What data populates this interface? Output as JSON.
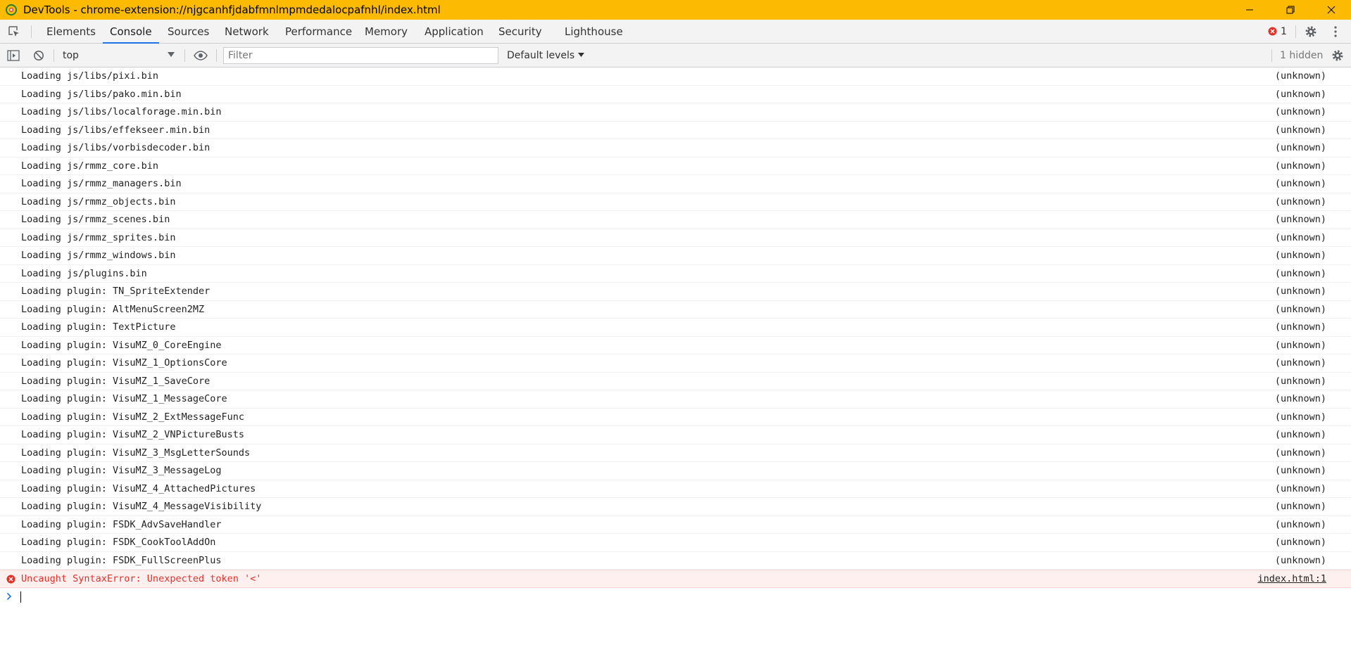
{
  "window": {
    "title": "DevTools - chrome-extension://njgcanhfjdabfmnlmpmdedalocpafnhl/index.html"
  },
  "tabs": [
    {
      "label": "Elements"
    },
    {
      "label": "Console",
      "selected": true
    },
    {
      "label": "Sources"
    },
    {
      "label": "Network"
    },
    {
      "label": "Performance"
    },
    {
      "label": "Memory"
    },
    {
      "label": "Application"
    },
    {
      "label": "Security"
    },
    {
      "label": "Lighthouse"
    }
  ],
  "error_badge": {
    "count": "1"
  },
  "console_toolbar": {
    "context": "top",
    "filter_placeholder": "Filter",
    "levels": "Default levels",
    "hidden": "1 hidden"
  },
  "messages": [
    {
      "text": "Loading js/libs/pixi.bin",
      "source": "(unknown)"
    },
    {
      "text": "Loading js/libs/pako.min.bin",
      "source": "(unknown)"
    },
    {
      "text": "Loading js/libs/localforage.min.bin",
      "source": "(unknown)"
    },
    {
      "text": "Loading js/libs/effekseer.min.bin",
      "source": "(unknown)"
    },
    {
      "text": "Loading js/libs/vorbisdecoder.bin",
      "source": "(unknown)"
    },
    {
      "text": "Loading js/rmmz_core.bin",
      "source": "(unknown)"
    },
    {
      "text": "Loading js/rmmz_managers.bin",
      "source": "(unknown)"
    },
    {
      "text": "Loading js/rmmz_objects.bin",
      "source": "(unknown)"
    },
    {
      "text": "Loading js/rmmz_scenes.bin",
      "source": "(unknown)"
    },
    {
      "text": "Loading js/rmmz_sprites.bin",
      "source": "(unknown)"
    },
    {
      "text": "Loading js/rmmz_windows.bin",
      "source": "(unknown)"
    },
    {
      "text": "Loading js/plugins.bin",
      "source": "(unknown)"
    },
    {
      "text": "Loading plugin: TN_SpriteExtender",
      "source": "(unknown)"
    },
    {
      "text": "Loading plugin: AltMenuScreen2MZ",
      "source": "(unknown)"
    },
    {
      "text": "Loading plugin: TextPicture",
      "source": "(unknown)"
    },
    {
      "text": "Loading plugin: VisuMZ_0_CoreEngine",
      "source": "(unknown)"
    },
    {
      "text": "Loading plugin: VisuMZ_1_OptionsCore",
      "source": "(unknown)"
    },
    {
      "text": "Loading plugin: VisuMZ_1_SaveCore",
      "source": "(unknown)"
    },
    {
      "text": "Loading plugin: VisuMZ_1_MessageCore",
      "source": "(unknown)"
    },
    {
      "text": "Loading plugin: VisuMZ_2_ExtMessageFunc",
      "source": "(unknown)"
    },
    {
      "text": "Loading plugin: VisuMZ_2_VNPictureBusts",
      "source": "(unknown)"
    },
    {
      "text": "Loading plugin: VisuMZ_3_MsgLetterSounds",
      "source": "(unknown)"
    },
    {
      "text": "Loading plugin: VisuMZ_3_MessageLog",
      "source": "(unknown)"
    },
    {
      "text": "Loading plugin: VisuMZ_4_AttachedPictures",
      "source": "(unknown)"
    },
    {
      "text": "Loading plugin: VisuMZ_4_MessageVisibility",
      "source": "(unknown)"
    },
    {
      "text": "Loading plugin: FSDK_AdvSaveHandler",
      "source": "(unknown)"
    },
    {
      "text": "Loading plugin: FSDK_CookToolAddOn",
      "source": "(unknown)"
    },
    {
      "text": "Loading plugin: FSDK_FullScreenPlus",
      "source": "(unknown)"
    }
  ],
  "error_message": {
    "text": "Uncaught SyntaxError: Unexpected token '<'",
    "source": "index.html:1"
  },
  "colors": {
    "titlebar": "#fdba03",
    "accent": "#1a73e8",
    "error": "#e0312b"
  }
}
